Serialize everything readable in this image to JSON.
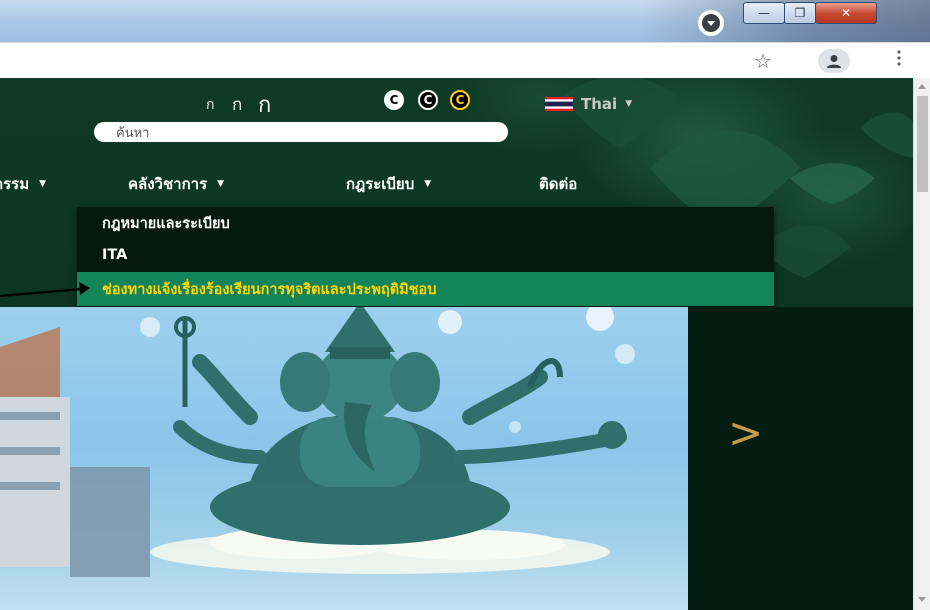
{
  "header": {
    "font_size_small": "ก",
    "font_size_medium": "ก",
    "font_size_large": "ก",
    "contrast_options": [
      "C",
      "C",
      "C"
    ],
    "language": {
      "label": "Thai",
      "flag_icon": "thai-flag-icon"
    }
  },
  "search": {
    "placeholder": "ค้นหา"
  },
  "nav": {
    "items": [
      {
        "label": "กรรม",
        "has_dropdown": true
      },
      {
        "label": "คลังวิชาการ",
        "has_dropdown": true
      },
      {
        "label": "กฎระเบียบ",
        "has_dropdown": true
      },
      {
        "label": "ติดต่อ",
        "has_dropdown": false
      }
    ],
    "caret": "▼"
  },
  "dropdown": {
    "parent": "กฎระเบียบ",
    "items": [
      {
        "label": "กฎหมายและระเบียบ"
      },
      {
        "label": "ITA"
      },
      {
        "label": "ช่องทางแจ้งเรื่องร้องเรียนการทุจริตและประพฤติมิชอบ",
        "highlighted": true
      }
    ]
  },
  "banner": {
    "next_arrow": ">",
    "subject": "ganesha-statue-image"
  },
  "browser": {
    "window_controls": [
      "—",
      "❐",
      "✕"
    ],
    "icons": [
      "profile-menu-icon",
      "star-icon",
      "account-avatar-icon",
      "kebab-menu-icon"
    ]
  },
  "colors": {
    "header_bg": "#0b3322",
    "dropdown_bg": "#05190f",
    "highlight_bg": "#14845a",
    "highlight_text": "#ffd400",
    "next_arrow": "#c79a4a"
  }
}
